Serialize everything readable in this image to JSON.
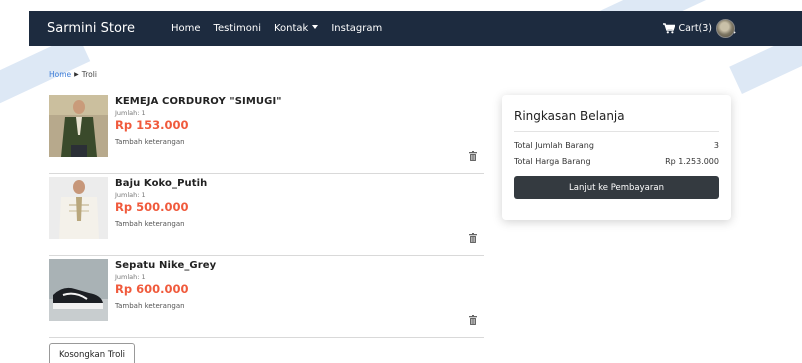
{
  "navbar": {
    "brand": "Sarmini Store",
    "links": [
      "Home",
      "Testimoni",
      "Kontak",
      "Instagram"
    ],
    "cart_label": "Cart(3)"
  },
  "breadcrumb": {
    "home": "Home",
    "current": "Troli"
  },
  "cart_items": [
    {
      "name": "KEMEJA CORDUROY \"SIMUGI\"",
      "qty": "Jumlah: 1",
      "price": "Rp 153.000",
      "note": "Tambah keterangan"
    },
    {
      "name": "Baju Koko_Putih",
      "qty": "Jumlah: 1",
      "price": "Rp 500.000",
      "note": "Tambah keterangan"
    },
    {
      "name": "Sepatu Nike_Grey",
      "qty": "Jumlah: 1",
      "price": "Rp 600.000",
      "note": "Tambah keterangan"
    }
  ],
  "empty_cart_label": "Kosongkan Troli",
  "summary": {
    "title": "Ringkasan Belanja",
    "total_qty_label": "Total Jumlah Barang",
    "total_qty_value": "3",
    "total_price_label": "Total Harga Barang",
    "total_price_value": "Rp 1.253.000",
    "checkout_label": "Lanjut ke Pembayaran"
  },
  "colors": {
    "navbar_bg": "#1d2b3f",
    "price": "#f05a3c",
    "link": "#3d7dd8",
    "checkout_bg": "#343a40"
  }
}
